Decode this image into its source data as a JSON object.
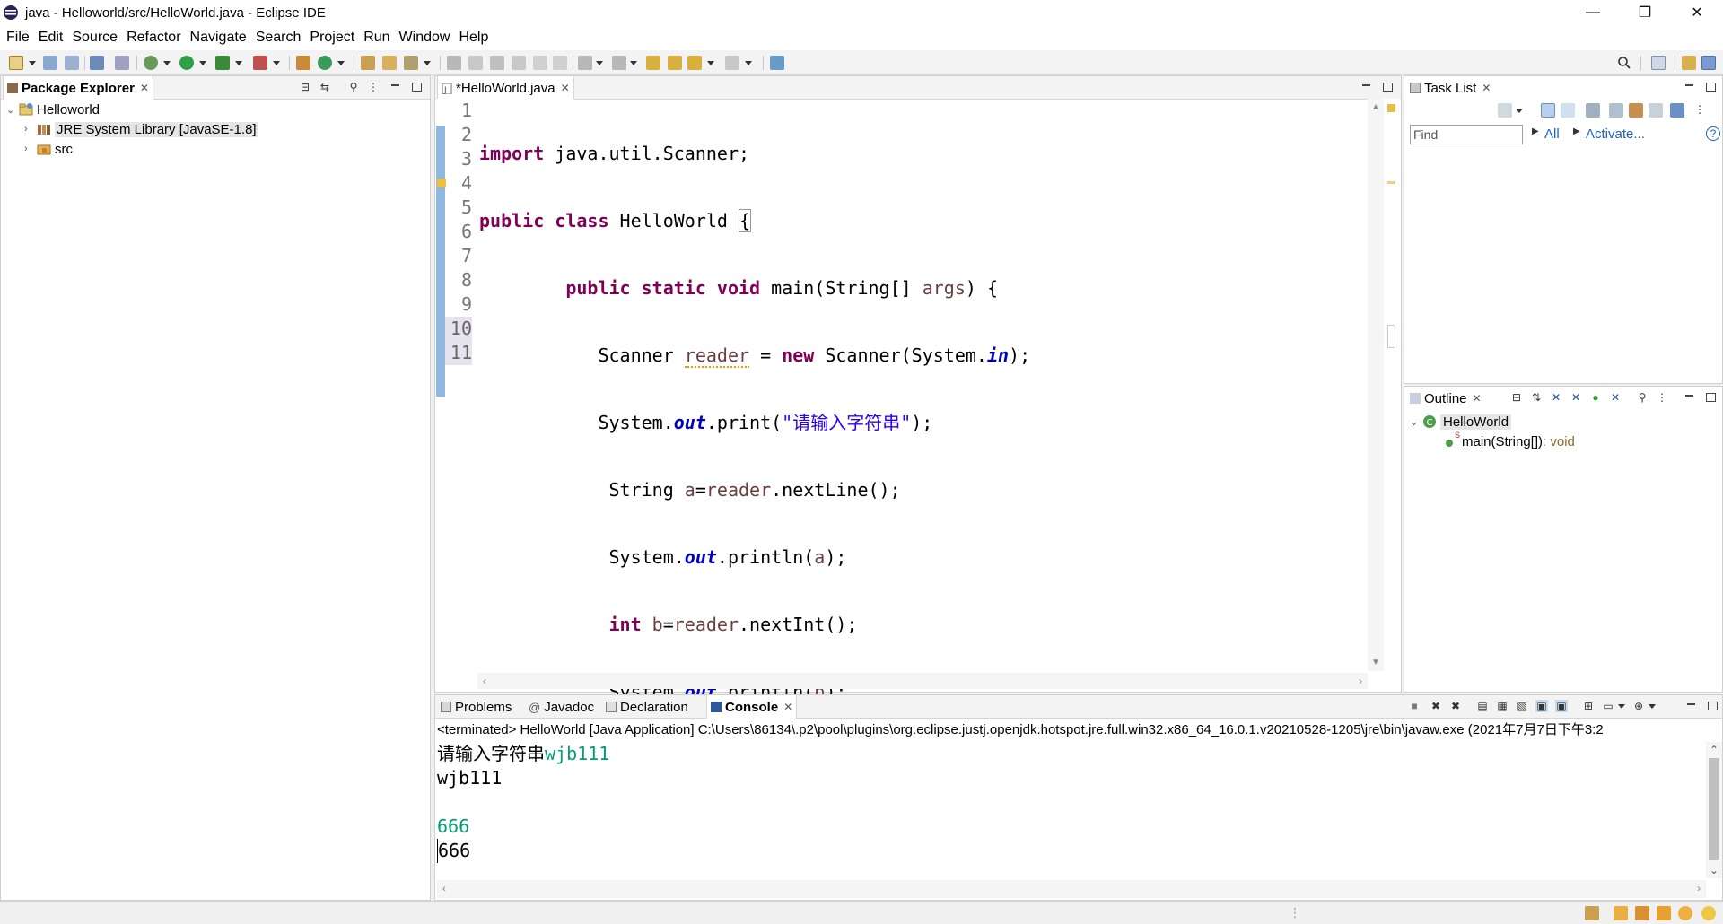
{
  "window": {
    "title": "java - Helloworld/src/HelloWorld.java - Eclipse IDE",
    "minimize": "—",
    "restore": "❐",
    "close": "✕"
  },
  "menu": [
    {
      "label": "File"
    },
    {
      "label": "Edit"
    },
    {
      "label": "Source"
    },
    {
      "label": "Refactor"
    },
    {
      "label": "Navigate"
    },
    {
      "label": "Search"
    },
    {
      "label": "Project"
    },
    {
      "label": "Run"
    },
    {
      "label": "Window"
    },
    {
      "label": "Help"
    }
  ],
  "package_explorer": {
    "tab_label": "Package Explorer",
    "tree": [
      {
        "label": "Helloworld",
        "icon": "project-icon",
        "expanded": true
      },
      {
        "label": "JRE System Library [JavaSE-1.8]",
        "icon": "library-icon"
      },
      {
        "label": "src",
        "icon": "package-folder-icon"
      }
    ]
  },
  "editor": {
    "tab_label": "*HelloWorld.java",
    "line_numbers": [
      "1",
      "2",
      "3",
      "4",
      "5",
      "6",
      "7",
      "8",
      "9",
      "10",
      "11"
    ],
    "code": {
      "l1_kw": "import",
      "l1_rest": " java.util.Scanner;",
      "l2_kw1": "public",
      "l2_kw2": "class",
      "l2_name": " HelloWorld ",
      "l2_brace": "{",
      "l3_indent": "        ",
      "l3_kw1": "public",
      "l3_kw2": "static",
      "l3_kw3": "void",
      "l3_rest1": " main(String[] ",
      "l3_param": "args",
      "l3_rest2": ") {",
      "l4_a": "           Scanner ",
      "l4_var": "reader",
      "l4_b": " = ",
      "l4_kw": "new",
      "l4_c": " Scanner(System.",
      "l4_fld": "in",
      "l4_d": ");",
      "l5_a": "           System.",
      "l5_fld": "out",
      "l5_b": ".print(",
      "l5_str1": "\"",
      "l5_str_zh": "请输入字符串",
      "l5_str2": "\"",
      "l5_c": ");",
      "l6_a": "            String ",
      "l6_var": "a",
      "l6_b": "=",
      "l6_var2": "reader",
      "l6_c": ".nextLine();",
      "l7_a": "            System.",
      "l7_fld": "out",
      "l7_b": ".println(",
      "l7_var": "a",
      "l7_c": ");",
      "l8_a": "            ",
      "l8_kw": "int",
      "l8_b": " ",
      "l8_var": "b",
      "l8_c": "=",
      "l8_var2": "reader",
      "l8_d": ".nextInt();",
      "l9_a": "            System.",
      "l9_fld": "out",
      "l9_b": ".println(",
      "l9_var": "b",
      "l9_c": ");",
      "l10": "             }",
      "l11": "}"
    }
  },
  "task_list": {
    "tab_label": "Task List",
    "find_placeholder": "Find",
    "all_label": "All",
    "activate_label": "Activate...",
    "help": "?"
  },
  "outline": {
    "tab_label": "Outline",
    "class_name": "HelloWorld",
    "method_name": "main(String[])",
    "method_type": " : void",
    "static_marker": "S"
  },
  "bottom": {
    "tabs": [
      {
        "label": "Problems"
      },
      {
        "label": "Javadoc"
      },
      {
        "label": "Declaration"
      },
      {
        "label": "Console"
      }
    ],
    "javadoc_prefix": "@",
    "console_header": "<terminated> HelloWorld [Java Application] C:\\Users\\86134\\.p2\\pool\\plugins\\org.eclipse.justj.openjdk.hotspot.jre.full.win32.x86_64_16.0.1.v20210528-1205\\jre\\bin\\javaw.exe  (2021年7月7日下午3:2",
    "output": {
      "prompt": "请输入字符串",
      "input1": "wjb111",
      "echo1": "wjb111",
      "input2": "666",
      "echo2": "666"
    }
  },
  "colors": {
    "keyword": "#7f0055",
    "field": "#0000c0",
    "string": "#2a00ff",
    "console_input": "#00a070"
  }
}
